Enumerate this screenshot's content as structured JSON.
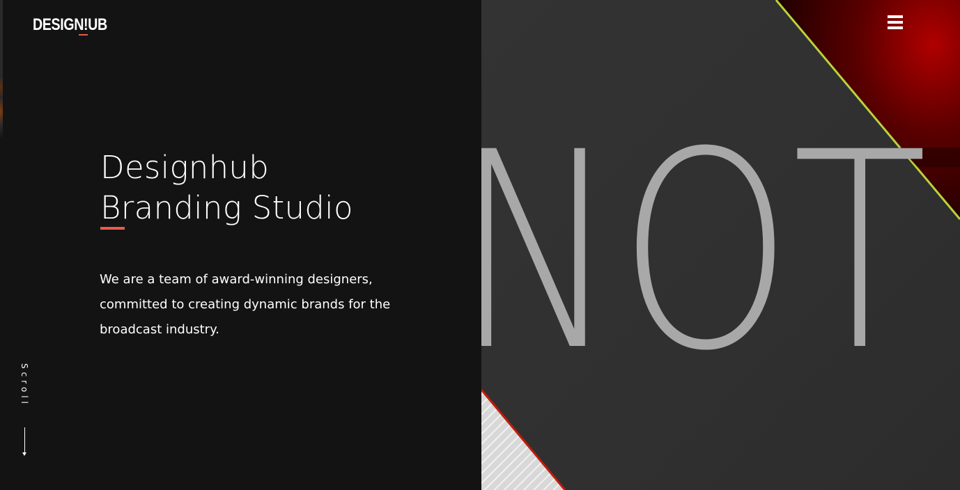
{
  "header": {
    "logo_text": "DESIGN!UB",
    "menu_icon": "hamburger-menu-icon"
  },
  "hero": {
    "title_line1": "Designhub",
    "title_line2": "Branding Studio",
    "description": "We are a team of award-winning designers, committed to creating dynamic brands for the broadcast industry."
  },
  "scroll": {
    "label": "Scroll",
    "icon": "arrow-down-icon"
  },
  "showcase": {
    "image_text": "NOT"
  },
  "colors": {
    "accent": "#ea5b4c",
    "background": "#131313",
    "image_dark": "#323232",
    "image_red": "#a30000",
    "image_line": "#b8d53a"
  }
}
